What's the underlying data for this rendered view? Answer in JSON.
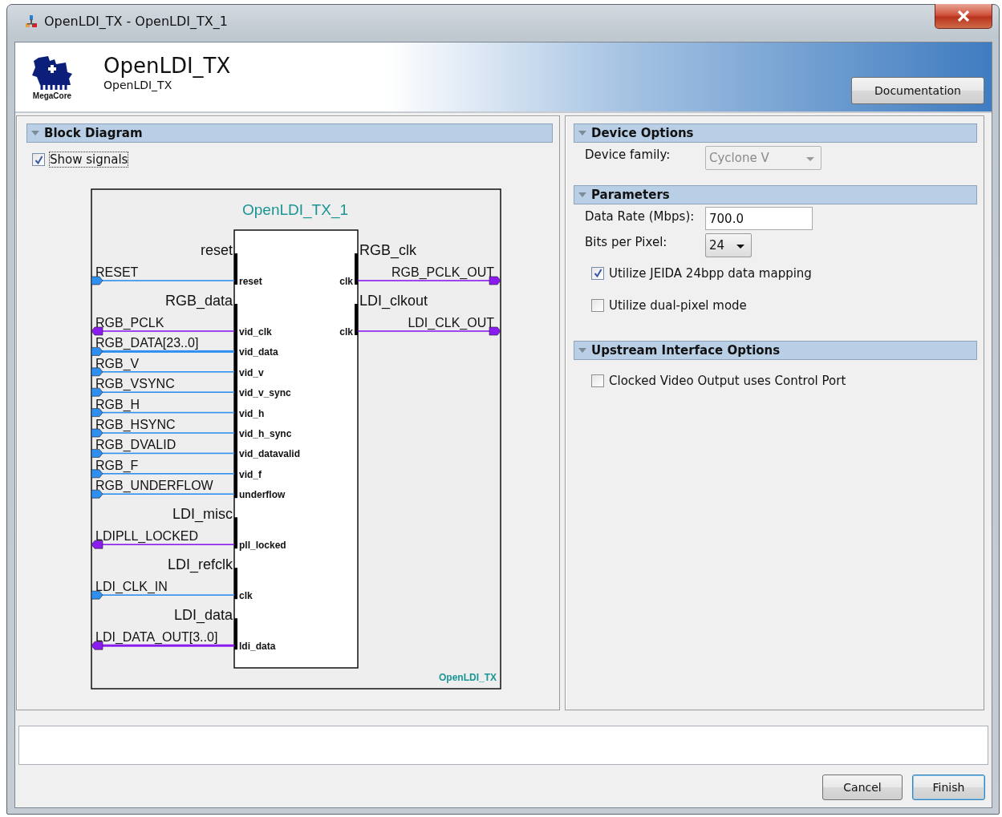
{
  "window": {
    "title": "OpenLDI_TX - OpenLDI_TX_1"
  },
  "header": {
    "logo_text": "MegaCore",
    "title": "OpenLDI_TX",
    "subtitle": "OpenLDI_TX",
    "documentation_button": "Documentation"
  },
  "block_diagram": {
    "heading": "Block Diagram",
    "expanded": true,
    "show_signals": {
      "label": "Show signals",
      "checked": true
    },
    "diagram": {
      "instance": "OpenLDI_TX_1",
      "component": "OpenLDI_TX",
      "left_interfaces": [
        {
          "name": "reset",
          "ports": [
            {
              "signal": "RESET",
              "port": "reset",
              "kind": "input",
              "bus": false
            }
          ]
        },
        {
          "name": "RGB_data",
          "ports": [
            {
              "signal": "RGB_PCLK",
              "port": "vid_clk",
              "kind": "output",
              "bus": false
            },
            {
              "signal": "RGB_DATA[23..0]",
              "port": "vid_data",
              "kind": "input",
              "bus": true
            },
            {
              "signal": "RGB_V",
              "port": "vid_v",
              "kind": "input",
              "bus": false
            },
            {
              "signal": "RGB_VSYNC",
              "port": "vid_v_sync",
              "kind": "input",
              "bus": false
            },
            {
              "signal": "RGB_H",
              "port": "vid_h",
              "kind": "input",
              "bus": false
            },
            {
              "signal": "RGB_HSYNC",
              "port": "vid_h_sync",
              "kind": "input",
              "bus": false
            },
            {
              "signal": "RGB_DVALID",
              "port": "vid_datavalid",
              "kind": "input",
              "bus": false
            },
            {
              "signal": "RGB_F",
              "port": "vid_f",
              "kind": "input",
              "bus": false
            },
            {
              "signal": "RGB_UNDERFLOW",
              "port": "underflow",
              "kind": "input",
              "bus": false
            }
          ]
        },
        {
          "name": "LDI_misc",
          "ports": [
            {
              "signal": "LDIPLL_LOCKED",
              "port": "pll_locked",
              "kind": "output",
              "bus": false
            }
          ]
        },
        {
          "name": "LDI_refclk",
          "ports": [
            {
              "signal": "LDI_CLK_IN",
              "port": "clk",
              "kind": "input",
              "bus": false
            }
          ]
        },
        {
          "name": "LDI_data",
          "ports": [
            {
              "signal": "LDI_DATA_OUT[3..0]",
              "port": "ldi_data",
              "kind": "output",
              "bus": true
            }
          ]
        }
      ],
      "right_interfaces": [
        {
          "name": "RGB_clk",
          "ports": [
            {
              "signal": "RGB_PCLK_OUT",
              "port": "clk",
              "kind": "output",
              "bus": false
            }
          ]
        },
        {
          "name": "LDI_clkout",
          "ports": [
            {
              "signal": "LDI_CLK_OUT",
              "port": "clk",
              "kind": "output",
              "bus": false
            }
          ]
        }
      ]
    }
  },
  "sections": [
    {
      "heading": "Device Options",
      "expanded": true,
      "fields": [
        {
          "kind": "dropdown",
          "label": "Device family:",
          "value": "Cyclone V",
          "disabled": true
        }
      ]
    },
    {
      "heading": "Parameters",
      "expanded": true,
      "fields": [
        {
          "kind": "text",
          "label": "Data Rate (Mbps):",
          "value": "700.0"
        },
        {
          "kind": "dropdown",
          "label": "Bits per Pixel:",
          "value": "24",
          "disabled": false
        },
        {
          "kind": "checkbox",
          "label": "Utilize JEIDA 24bpp data mapping",
          "checked": true
        },
        {
          "kind": "checkbox",
          "label": "Utilize dual-pixel mode",
          "checked": false
        }
      ]
    },
    {
      "heading": "Upstream Interface Options",
      "expanded": true,
      "fields": [
        {
          "kind": "checkbox",
          "label": "Clocked Video Output uses Control Port",
          "checked": false
        }
      ]
    }
  ],
  "buttons": [
    {
      "label": "Cancel",
      "default": false
    },
    {
      "label": "Finish",
      "default": true
    }
  ]
}
